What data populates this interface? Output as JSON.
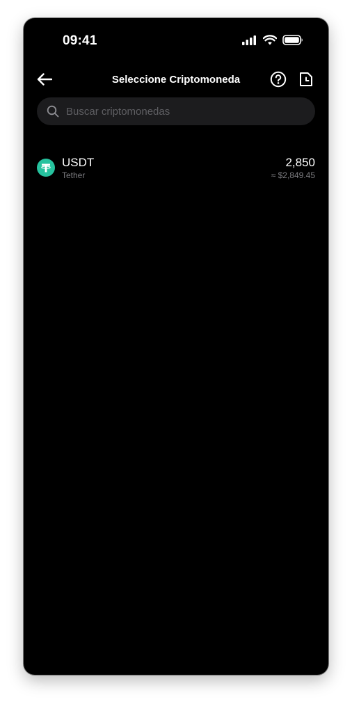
{
  "status_bar": {
    "time": "09:41",
    "icons": [
      "cellular-signal-icon",
      "wifi-icon",
      "battery-icon"
    ]
  },
  "header": {
    "title": "Seleccione Criptomoneda",
    "back_icon": "arrow-left-icon",
    "help_icon": "question-circle-icon",
    "history_icon": "document-clock-icon"
  },
  "search": {
    "placeholder": "Buscar criptomonedas",
    "value": "",
    "icon": "search-icon"
  },
  "coins": [
    {
      "symbol": "USDT",
      "name": "Tether",
      "amount": "2,850",
      "fiat_value": "≈ $2,849.45",
      "icon": "tether-logo-icon",
      "color": "#26c29e"
    }
  ],
  "colors": {
    "background": "#000000",
    "search_bg": "#1c1c1e",
    "secondary_text": "#7c7c80",
    "tether_green": "#26c29e"
  }
}
